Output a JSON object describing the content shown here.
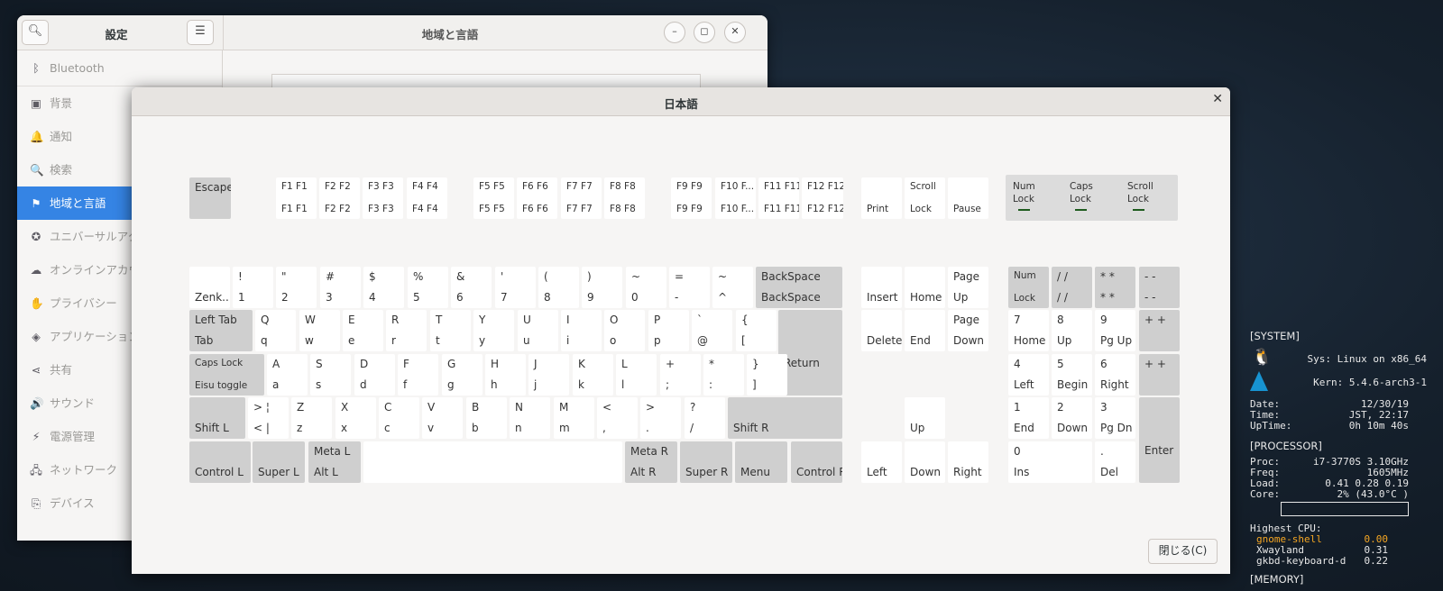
{
  "settings": {
    "title": "設定",
    "page_title": "地域と言語",
    "sidebar": [
      {
        "label": "Bluetooth",
        "icon": "bluetooth-icon",
        "glyph": "ᛒ"
      },
      {
        "label": "背景",
        "icon": "background-icon",
        "glyph": "▣"
      },
      {
        "label": "通知",
        "icon": "bell-icon",
        "glyph": "🔔"
      },
      {
        "label": "検索",
        "icon": "search-icon",
        "glyph": "🔍"
      },
      {
        "label": "地域と言語",
        "icon": "flag-icon",
        "glyph": "⚑",
        "active": true
      },
      {
        "label": "ユニバーサルアクセス",
        "icon": "accessibility-icon",
        "glyph": "✪"
      },
      {
        "label": "オンラインアカウント",
        "icon": "cloud-icon",
        "glyph": "☁"
      },
      {
        "label": "プライバシー",
        "icon": "hand-icon",
        "glyph": "✋"
      },
      {
        "label": "アプリケーション",
        "icon": "apps-icon",
        "glyph": "◈"
      },
      {
        "label": "共有",
        "icon": "share-icon",
        "glyph": "⋖"
      },
      {
        "label": "サウンド",
        "icon": "speaker-icon",
        "glyph": "🔊"
      },
      {
        "label": "電源管理",
        "icon": "power-icon",
        "glyph": "⚡"
      },
      {
        "label": "ネットワーク",
        "icon": "network-icon",
        "glyph": "🖧"
      },
      {
        "label": "デバイス",
        "icon": "devices-icon",
        "glyph": "⎘"
      }
    ]
  },
  "dialog": {
    "title": "日本語",
    "close_label": "閉じる(C)"
  },
  "keyboard": {
    "function_row": [
      {
        "t": "Escape",
        "mod": true
      },
      {
        "t": "F1  F1",
        "b": "F1  F1"
      },
      {
        "t": "F2  F2",
        "b": "F2  F2"
      },
      {
        "t": "F3  F3",
        "b": "F3  F3"
      },
      {
        "t": "F4  F4",
        "b": "F4  F4"
      },
      {
        "t": "F5  F5",
        "b": "F5  F5"
      },
      {
        "t": "F6  F6",
        "b": "F6  F6"
      },
      {
        "t": "F7  F7",
        "b": "F7  F7"
      },
      {
        "t": "F8  F8",
        "b": "F8  F8"
      },
      {
        "t": "F9  F9",
        "b": "F9  F9"
      },
      {
        "t": "F10 F...",
        "b": "F10 F..."
      },
      {
        "t": "F11 F11",
        "b": "F11 F11"
      },
      {
        "t": "F12 F12",
        "b": "F12 F12"
      },
      {
        "b": "Print"
      },
      {
        "t": "Scroll",
        "b": "Lock"
      },
      {
        "b": "Pause"
      }
    ],
    "lock_indicators": [
      {
        "t": "Num",
        "b": "Lock"
      },
      {
        "t": "Caps",
        "b": "Lock"
      },
      {
        "t": "Scroll",
        "b": "Lock"
      }
    ],
    "row1": [
      {
        "b": "Zenk..."
      },
      {
        "t": "!",
        "b": "1"
      },
      {
        "t": "\"",
        "b": "2"
      },
      {
        "t": "#",
        "b": "3"
      },
      {
        "t": "$",
        "b": "4"
      },
      {
        "t": "%",
        "b": "5"
      },
      {
        "t": "&",
        "b": "6"
      },
      {
        "t": "'",
        "b": "7"
      },
      {
        "t": "(",
        "b": "8"
      },
      {
        "t": ")",
        "b": "9"
      },
      {
        "t": "~",
        "b": "0"
      },
      {
        "t": "=",
        "b": "-"
      },
      {
        "t": "~",
        "b": "^"
      },
      {
        "t": "BackSpace",
        "b": "BackSpace",
        "mod": true
      }
    ],
    "row2": [
      {
        "t": "Left Tab",
        "b": "Tab",
        "mod": true
      },
      {
        "t": "Q",
        "b": "q"
      },
      {
        "t": "W",
        "b": "w"
      },
      {
        "t": "E",
        "b": "e"
      },
      {
        "t": "R",
        "b": "r"
      },
      {
        "t": "T",
        "b": "t"
      },
      {
        "t": "Y",
        "b": "y"
      },
      {
        "t": "U",
        "b": "u"
      },
      {
        "t": "I",
        "b": "i"
      },
      {
        "t": "O",
        "b": "o"
      },
      {
        "t": "P",
        "b": "p"
      },
      {
        "t": "`",
        "b": "@"
      },
      {
        "t": "{",
        "b": "["
      },
      {
        "t": "Return",
        "mod": true
      }
    ],
    "row3": [
      {
        "t": "Caps Lock",
        "b": "Eisu toggle",
        "mod": true
      },
      {
        "t": "A",
        "b": "a"
      },
      {
        "t": "S",
        "b": "s"
      },
      {
        "t": "D",
        "b": "d"
      },
      {
        "t": "F",
        "b": "f"
      },
      {
        "t": "G",
        "b": "g"
      },
      {
        "t": "H",
        "b": "h"
      },
      {
        "t": "J",
        "b": "j"
      },
      {
        "t": "K",
        "b": "k"
      },
      {
        "t": "L",
        "b": "l"
      },
      {
        "t": "+",
        "b": ";"
      },
      {
        "t": "*",
        "b": ":"
      },
      {
        "t": "}",
        "b": "]"
      }
    ],
    "row4": [
      {
        "b": "Shift L",
        "mod": true
      },
      {
        "t": ">  ¦",
        "b": "<  |"
      },
      {
        "t": "Z",
        "b": "z"
      },
      {
        "t": "X",
        "b": "x"
      },
      {
        "t": "C",
        "b": "c"
      },
      {
        "t": "V",
        "b": "v"
      },
      {
        "t": "B",
        "b": "b"
      },
      {
        "t": "N",
        "b": "n"
      },
      {
        "t": "M",
        "b": "m"
      },
      {
        "t": "<",
        "b": ","
      },
      {
        "t": ">",
        "b": "."
      },
      {
        "t": "?",
        "b": "/"
      },
      {
        "b": "Shift R",
        "mod": true
      }
    ],
    "row5": [
      {
        "b": "Control L",
        "mod": true
      },
      {
        "b": "Super L",
        "mod": true
      },
      {
        "t": "Meta L",
        "b": "Alt L",
        "mod": true
      },
      {
        "b": ""
      },
      {
        "t": "Meta R",
        "b": "Alt R",
        "mod": true
      },
      {
        "b": "Super R",
        "mod": true
      },
      {
        "b": "Menu",
        "mod": true
      },
      {
        "b": "Control R",
        "mod": true
      }
    ],
    "nav": [
      {
        "b": "Insert"
      },
      {
        "b": "Home"
      },
      {
        "t": "Page",
        "b": "Up"
      },
      {
        "b": "Delete"
      },
      {
        "b": "End"
      },
      {
        "t": "Page",
        "b": "Down"
      },
      {
        "b": "Up"
      },
      {
        "b": "Left"
      },
      {
        "b": "Down"
      },
      {
        "b": "Right"
      }
    ],
    "numpad": [
      {
        "t": "Num",
        "b": "Lock",
        "mod": true
      },
      {
        "t": "/   /",
        "b": "/   /",
        "mod": true
      },
      {
        "t": "*   *",
        "b": "*   *",
        "mod": true
      },
      {
        "t": "-   -",
        "b": "-   -",
        "mod": true
      },
      {
        "t": "7",
        "b": "Home"
      },
      {
        "t": "8",
        "b": "Up"
      },
      {
        "t": "9",
        "b": "Pg Up"
      },
      {
        "t": "+   +",
        "mod": true
      },
      {
        "t": "4",
        "b": "Left"
      },
      {
        "t": "5",
        "b": "Begin"
      },
      {
        "t": "6",
        "b": "Right"
      },
      {
        "t": "+   +",
        "mod": true
      },
      {
        "t": "1",
        "b": "End"
      },
      {
        "t": "2",
        "b": "Down"
      },
      {
        "t": "3",
        "b": "Pg Dn"
      },
      {
        "t": "Enter",
        "mod": true
      },
      {
        "t": "0",
        "b": "Ins"
      },
      {
        "t": ".",
        "b": "Del"
      }
    ]
  },
  "conky": {
    "system_header": "[SYSTEM]",
    "sys": "Sys: Linux on x86_64",
    "kern": "Kern: 5.4.6-arch3-1",
    "date_label": "Date:",
    "date": "12/30/19",
    "time_label": "Time:",
    "time": "JST, 22:17",
    "uptime_label": "UpTime:",
    "uptime": "0h 10m 40s",
    "processor_header": "[PROCESSOR]",
    "proc_label": "Proc:",
    "proc": "i7-3770S 3.10GHz",
    "freq_label": "Freq:",
    "freq": "1605MHz",
    "load_label": "Load:",
    "load": "0.41 0.28 0.19",
    "core_label": "Core:",
    "core": "2% (43.0°C )",
    "highest_cpu_label": "Highest CPU:",
    "top": [
      {
        "name": "gnome-shell",
        "value": "0.00"
      },
      {
        "name": "Xwayland",
        "value": "0.31"
      },
      {
        "name": "gkbd-keyboard-d",
        "value": "0.22"
      }
    ],
    "memory_header": "[MEMORY]"
  }
}
